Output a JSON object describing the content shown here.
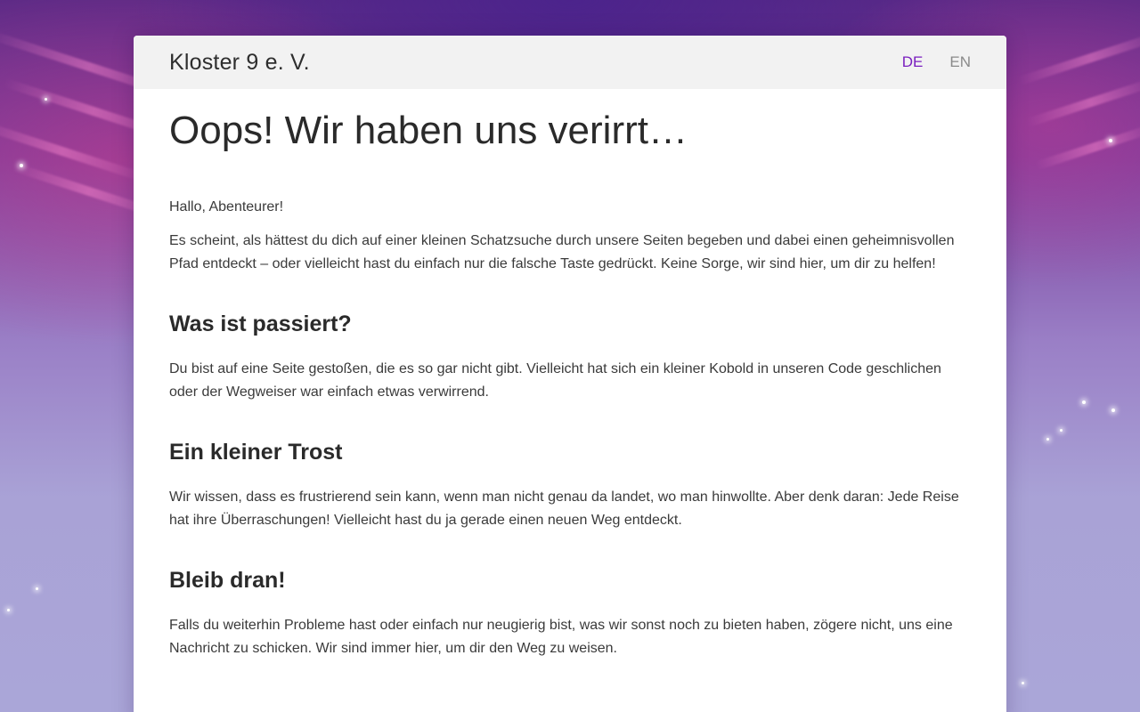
{
  "header": {
    "site_title": "Kloster 9 e. V.",
    "languages": [
      {
        "label": "DE",
        "active": true
      },
      {
        "label": "EN",
        "active": false
      }
    ],
    "accent_color": "#7a1fbf"
  },
  "content": {
    "title": "Oops! Wir haben uns verirrt…",
    "greeting": "Hallo, Abenteurer!",
    "intro": "Es scheint, als hättest du dich auf einer kleinen Schatzsuche durch unsere Seiten begeben und dabei einen geheimnisvollen Pfad entdeckt – oder vielleicht hast du einfach nur die falsche Taste gedrückt. Keine Sorge, wir sind hier, um dir zu helfen!",
    "sections": [
      {
        "heading": "Was ist passiert?",
        "text": "Du bist auf eine Seite gestoßen, die es so gar nicht gibt. Vielleicht hat sich ein kleiner Kobold in unseren Code geschlichen oder der Wegweiser war einfach etwas verwirrend."
      },
      {
        "heading": "Ein kleiner Trost",
        "text": "Wir wissen, dass es frustrierend sein kann, wenn man nicht genau da landet, wo man hinwollte. Aber denk daran: Jede Reise hat ihre Überraschungen! Vielleicht hast du ja gerade einen neuen Weg entdeckt."
      },
      {
        "heading": "Bleib dran!",
        "text": "Falls du weiterhin Probleme hast oder einfach nur neugierig bist, was wir sonst noch zu bieten haben, zögere nicht, uns eine Nachricht zu schicken. Wir sind immer hier, um dir den Weg zu weisen."
      }
    ]
  }
}
